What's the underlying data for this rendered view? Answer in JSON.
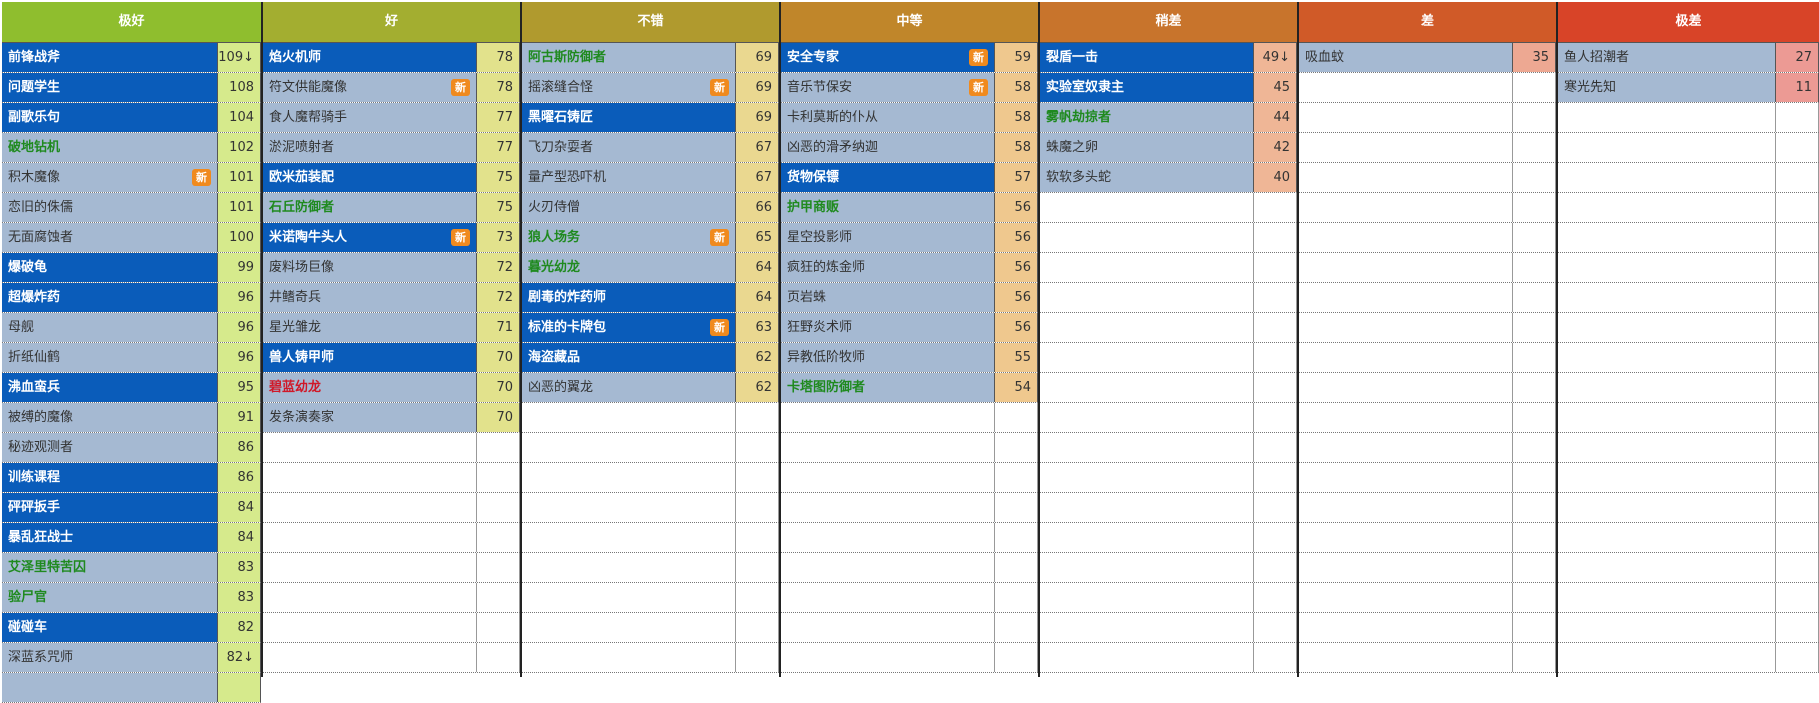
{
  "columns": [
    {
      "title": "极好",
      "header_color": "#8fbe2e",
      "score_color": "#d6ea8c",
      "rows": [
        {
          "name": "前锋战斧",
          "score": "109↓",
          "style": "blue",
          "badge": ""
        },
        {
          "name": "问题学生",
          "score": "108",
          "style": "blue",
          "badge": ""
        },
        {
          "name": "副歌乐句",
          "score": "104",
          "style": "blue",
          "badge": ""
        },
        {
          "name": "破地钻机",
          "score": "102",
          "style": "green",
          "badge": ""
        },
        {
          "name": "积木魔像",
          "score": "101",
          "style": "gray",
          "badge": "新"
        },
        {
          "name": "恋旧的侏儒",
          "score": "101",
          "style": "gray",
          "badge": ""
        },
        {
          "name": "无面腐蚀者",
          "score": "100",
          "style": "gray",
          "badge": ""
        },
        {
          "name": "爆破龟",
          "score": "99",
          "style": "blue",
          "badge": ""
        },
        {
          "name": "超爆炸药",
          "score": "96",
          "style": "blue",
          "badge": ""
        },
        {
          "name": "母舰",
          "score": "96",
          "style": "gray",
          "badge": ""
        },
        {
          "name": "折纸仙鹤",
          "score": "96",
          "style": "gray",
          "badge": ""
        },
        {
          "name": "沸血蛮兵",
          "score": "95",
          "style": "blue",
          "badge": ""
        },
        {
          "name": "被缚的魔像",
          "score": "91",
          "style": "gray",
          "badge": ""
        },
        {
          "name": "秘迹观测者",
          "score": "86",
          "style": "gray",
          "badge": ""
        },
        {
          "name": "训练课程",
          "score": "86",
          "style": "blue",
          "badge": ""
        },
        {
          "name": "砰砰扳手",
          "score": "84",
          "style": "blue",
          "badge": ""
        },
        {
          "name": "暴乱狂战士",
          "score": "84",
          "style": "blue",
          "badge": ""
        },
        {
          "name": "艾泽里特苦囚",
          "score": "83",
          "style": "green",
          "badge": ""
        },
        {
          "name": "验尸官",
          "score": "83",
          "style": "green",
          "badge": ""
        },
        {
          "name": "碰碰车",
          "score": "82",
          "style": "blue",
          "badge": ""
        },
        {
          "name": "深蓝系咒师",
          "score": "82↓",
          "style": "gray",
          "badge": ""
        },
        {
          "name": "",
          "score": "",
          "style": "gray",
          "badge": ""
        }
      ]
    },
    {
      "title": "好",
      "header_color": "#a3ae30",
      "score_color": "#e2e28c",
      "rows": [
        {
          "name": "焰火机师",
          "score": "78",
          "style": "blue",
          "badge": ""
        },
        {
          "name": "符文供能魔像",
          "score": "78",
          "style": "gray",
          "badge": "新"
        },
        {
          "name": "食人魔帮骑手",
          "score": "77",
          "style": "gray",
          "badge": ""
        },
        {
          "name": "淤泥喷射者",
          "score": "77",
          "style": "gray",
          "badge": ""
        },
        {
          "name": "欧米茄装配",
          "score": "75",
          "style": "blue",
          "badge": ""
        },
        {
          "name": "石丘防御者",
          "score": "75",
          "style": "green",
          "badge": ""
        },
        {
          "name": "米诺陶牛头人",
          "score": "73",
          "style": "blue",
          "badge": "新"
        },
        {
          "name": "废料场巨像",
          "score": "72",
          "style": "gray",
          "badge": ""
        },
        {
          "name": "井鳍奇兵",
          "score": "72",
          "style": "gray",
          "badge": ""
        },
        {
          "name": "星光雏龙",
          "score": "71",
          "style": "gray",
          "badge": ""
        },
        {
          "name": "兽人铸甲师",
          "score": "70",
          "style": "blue",
          "badge": ""
        },
        {
          "name": "碧蓝幼龙",
          "score": "70",
          "style": "red",
          "badge": ""
        },
        {
          "name": "发条演奏家",
          "score": "70",
          "style": "gray",
          "badge": ""
        }
      ]
    },
    {
      "title": "不错",
      "header_color": "#b09a2e",
      "score_color": "#ead890",
      "rows": [
        {
          "name": "阿古斯防御者",
          "score": "69",
          "style": "green",
          "badge": ""
        },
        {
          "name": "摇滚缝合怪",
          "score": "69",
          "style": "gray",
          "badge": "新"
        },
        {
          "name": "黑曜石铸匠",
          "score": "69",
          "style": "blue",
          "badge": ""
        },
        {
          "name": "飞刀杂耍者",
          "score": "67",
          "style": "gray",
          "badge": ""
        },
        {
          "name": "量产型恐吓机",
          "score": "67",
          "style": "gray",
          "badge": ""
        },
        {
          "name": "火刃侍僧",
          "score": "66",
          "style": "gray",
          "badge": ""
        },
        {
          "name": "狼人场务",
          "score": "65",
          "style": "green",
          "badge": "新"
        },
        {
          "name": "暮光幼龙",
          "score": "64",
          "style": "green",
          "badge": ""
        },
        {
          "name": "剧毒的炸药师",
          "score": "64",
          "style": "blue",
          "badge": ""
        },
        {
          "name": "标准的卡牌包",
          "score": "63",
          "style": "blue",
          "badge": "新"
        },
        {
          "name": "海盗藏品",
          "score": "62",
          "style": "blue",
          "badge": ""
        },
        {
          "name": "凶恶的翼龙",
          "score": "62",
          "style": "gray",
          "badge": ""
        }
      ]
    },
    {
      "title": "中等",
      "header_color": "#c0862a",
      "score_color": "#efc88e",
      "rows": [
        {
          "name": "安全专家",
          "score": "59",
          "style": "blue",
          "badge": "新"
        },
        {
          "name": "音乐节保安",
          "score": "58",
          "style": "gray",
          "badge": "新"
        },
        {
          "name": "卡利莫斯的仆从",
          "score": "58",
          "style": "gray",
          "badge": ""
        },
        {
          "name": "凶恶的滑矛纳迦",
          "score": "58",
          "style": "gray",
          "badge": ""
        },
        {
          "name": "货物保镖",
          "score": "57",
          "style": "blue",
          "badge": ""
        },
        {
          "name": "护甲商贩",
          "score": "56",
          "style": "green",
          "badge": ""
        },
        {
          "name": "星空投影师",
          "score": "56",
          "style": "gray",
          "badge": ""
        },
        {
          "name": "疯狂的炼金师",
          "score": "56",
          "style": "gray",
          "badge": ""
        },
        {
          "name": "页岩蛛",
          "score": "56",
          "style": "gray",
          "badge": ""
        },
        {
          "name": "狂野炎术师",
          "score": "56",
          "style": "gray",
          "badge": ""
        },
        {
          "name": "异教低阶牧师",
          "score": "55",
          "style": "gray",
          "badge": ""
        },
        {
          "name": "卡塔图防御者",
          "score": "54",
          "style": "green",
          "badge": ""
        }
      ]
    },
    {
      "title": "稍差",
      "header_color": "#c8742c",
      "score_color": "#efb696",
      "rows": [
        {
          "name": "裂盾一击",
          "score": "49↓",
          "style": "blue",
          "badge": ""
        },
        {
          "name": "实验室奴隶主",
          "score": "45",
          "style": "blue",
          "badge": ""
        },
        {
          "name": "雾帆劫掠者",
          "score": "44",
          "style": "green",
          "badge": ""
        },
        {
          "name": "蛛魔之卵",
          "score": "42",
          "style": "gray",
          "badge": ""
        },
        {
          "name": "软软多头蛇",
          "score": "40",
          "style": "gray",
          "badge": ""
        }
      ]
    },
    {
      "title": "差",
      "header_color": "#d05a28",
      "score_color": "#eda892",
      "rows": [
        {
          "name": "吸血蚊",
          "score": "35",
          "style": "gray",
          "badge": ""
        }
      ]
    },
    {
      "title": "极差",
      "header_color": "#d84428",
      "score_color": "#ec9a94",
      "rows": [
        {
          "name": "鱼人招潮者",
          "score": "27",
          "style": "gray",
          "badge": ""
        },
        {
          "name": "寒光先知",
          "score": "11",
          "style": "gray",
          "badge": ""
        }
      ]
    }
  ]
}
